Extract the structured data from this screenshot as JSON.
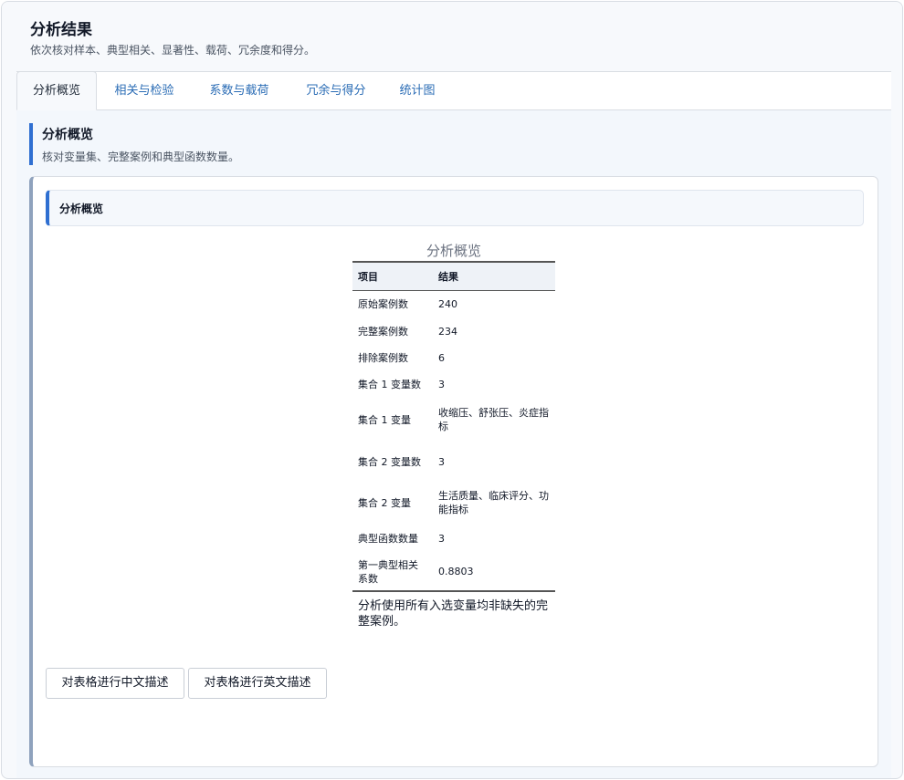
{
  "header": {
    "title": "分析结果",
    "subtitle": "依次核对样本、典型相关、显著性、载荷、冗余度和得分。"
  },
  "tabs": [
    {
      "label": "分析概览"
    },
    {
      "label": "相关与检验"
    },
    {
      "label": "系数与载荷"
    },
    {
      "label": "冗余与得分"
    },
    {
      "label": "统计图"
    }
  ],
  "section": {
    "title": "分析概览",
    "subtitle": "核对变量集、完整案例和典型函数数量。"
  },
  "card": {
    "title": "分析概览",
    "table": {
      "caption": "分析概览",
      "headers": [
        "项目",
        "结果"
      ],
      "rows": [
        [
          "原始案例数",
          "240"
        ],
        [
          "完整案例数",
          "234"
        ],
        [
          "排除案例数",
          "6"
        ],
        [
          "集合 1 变量数",
          "3"
        ],
        [
          "集合 1 变量",
          "收缩压、舒张压、炎症指标"
        ],
        [
          "集合 2 变量数",
          "3"
        ],
        [
          "集合 2 变量",
          "生活质量、临床评分、功能指标"
        ],
        [
          "典型函数数量",
          "3"
        ],
        [
          "第一典型相关系数",
          "0.8803"
        ]
      ],
      "note": "分析使用所有入选变量均非缺失的完整案例。"
    },
    "buttons": {
      "zh": "对表格进行中文描述",
      "en": "对表格进行英文描述"
    }
  }
}
